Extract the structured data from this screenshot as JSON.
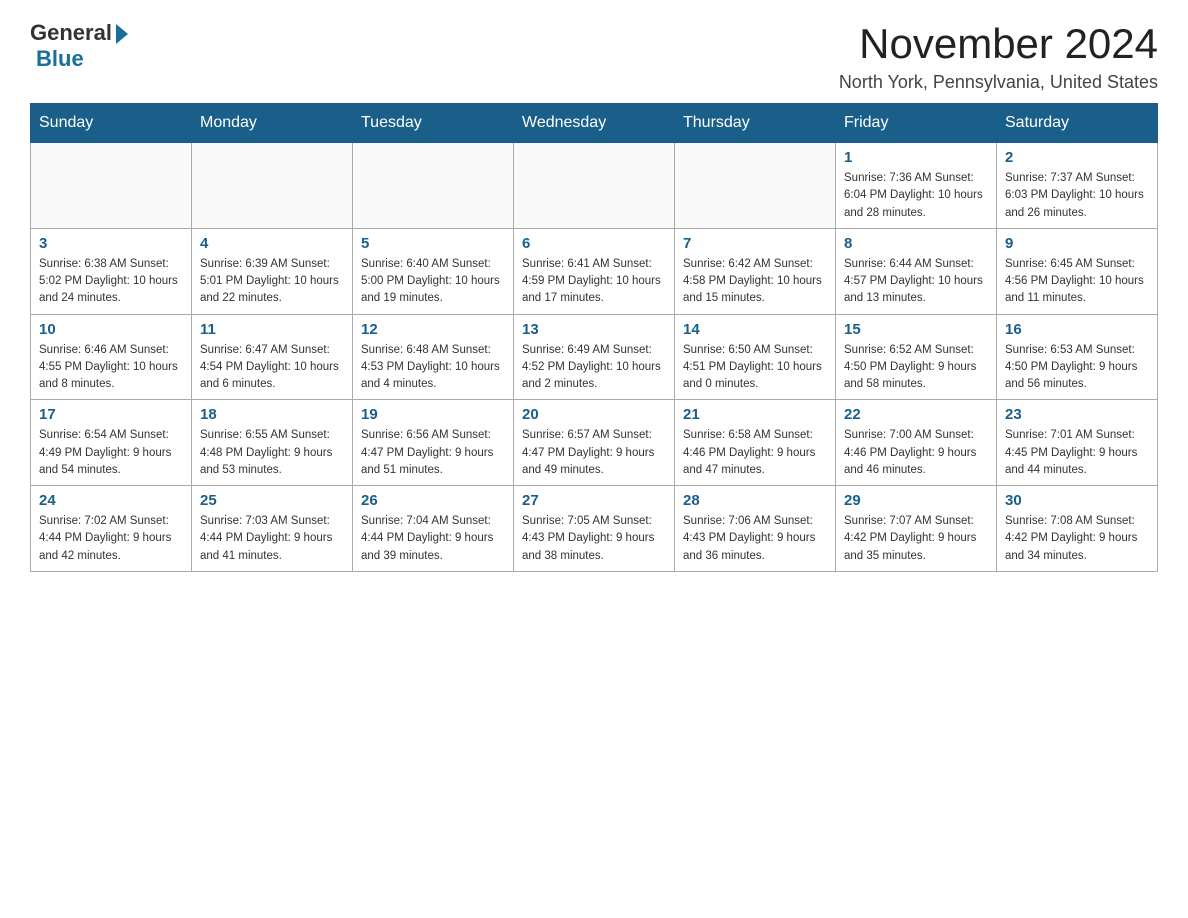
{
  "header": {
    "logo_general": "General",
    "logo_blue": "Blue",
    "month_year": "November 2024",
    "location": "North York, Pennsylvania, United States"
  },
  "days_of_week": [
    "Sunday",
    "Monday",
    "Tuesday",
    "Wednesday",
    "Thursday",
    "Friday",
    "Saturday"
  ],
  "weeks": [
    [
      {
        "day": "",
        "info": ""
      },
      {
        "day": "",
        "info": ""
      },
      {
        "day": "",
        "info": ""
      },
      {
        "day": "",
        "info": ""
      },
      {
        "day": "",
        "info": ""
      },
      {
        "day": "1",
        "info": "Sunrise: 7:36 AM\nSunset: 6:04 PM\nDaylight: 10 hours and 28 minutes."
      },
      {
        "day": "2",
        "info": "Sunrise: 7:37 AM\nSunset: 6:03 PM\nDaylight: 10 hours and 26 minutes."
      }
    ],
    [
      {
        "day": "3",
        "info": "Sunrise: 6:38 AM\nSunset: 5:02 PM\nDaylight: 10 hours and 24 minutes."
      },
      {
        "day": "4",
        "info": "Sunrise: 6:39 AM\nSunset: 5:01 PM\nDaylight: 10 hours and 22 minutes."
      },
      {
        "day": "5",
        "info": "Sunrise: 6:40 AM\nSunset: 5:00 PM\nDaylight: 10 hours and 19 minutes."
      },
      {
        "day": "6",
        "info": "Sunrise: 6:41 AM\nSunset: 4:59 PM\nDaylight: 10 hours and 17 minutes."
      },
      {
        "day": "7",
        "info": "Sunrise: 6:42 AM\nSunset: 4:58 PM\nDaylight: 10 hours and 15 minutes."
      },
      {
        "day": "8",
        "info": "Sunrise: 6:44 AM\nSunset: 4:57 PM\nDaylight: 10 hours and 13 minutes."
      },
      {
        "day": "9",
        "info": "Sunrise: 6:45 AM\nSunset: 4:56 PM\nDaylight: 10 hours and 11 minutes."
      }
    ],
    [
      {
        "day": "10",
        "info": "Sunrise: 6:46 AM\nSunset: 4:55 PM\nDaylight: 10 hours and 8 minutes."
      },
      {
        "day": "11",
        "info": "Sunrise: 6:47 AM\nSunset: 4:54 PM\nDaylight: 10 hours and 6 minutes."
      },
      {
        "day": "12",
        "info": "Sunrise: 6:48 AM\nSunset: 4:53 PM\nDaylight: 10 hours and 4 minutes."
      },
      {
        "day": "13",
        "info": "Sunrise: 6:49 AM\nSunset: 4:52 PM\nDaylight: 10 hours and 2 minutes."
      },
      {
        "day": "14",
        "info": "Sunrise: 6:50 AM\nSunset: 4:51 PM\nDaylight: 10 hours and 0 minutes."
      },
      {
        "day": "15",
        "info": "Sunrise: 6:52 AM\nSunset: 4:50 PM\nDaylight: 9 hours and 58 minutes."
      },
      {
        "day": "16",
        "info": "Sunrise: 6:53 AM\nSunset: 4:50 PM\nDaylight: 9 hours and 56 minutes."
      }
    ],
    [
      {
        "day": "17",
        "info": "Sunrise: 6:54 AM\nSunset: 4:49 PM\nDaylight: 9 hours and 54 minutes."
      },
      {
        "day": "18",
        "info": "Sunrise: 6:55 AM\nSunset: 4:48 PM\nDaylight: 9 hours and 53 minutes."
      },
      {
        "day": "19",
        "info": "Sunrise: 6:56 AM\nSunset: 4:47 PM\nDaylight: 9 hours and 51 minutes."
      },
      {
        "day": "20",
        "info": "Sunrise: 6:57 AM\nSunset: 4:47 PM\nDaylight: 9 hours and 49 minutes."
      },
      {
        "day": "21",
        "info": "Sunrise: 6:58 AM\nSunset: 4:46 PM\nDaylight: 9 hours and 47 minutes."
      },
      {
        "day": "22",
        "info": "Sunrise: 7:00 AM\nSunset: 4:46 PM\nDaylight: 9 hours and 46 minutes."
      },
      {
        "day": "23",
        "info": "Sunrise: 7:01 AM\nSunset: 4:45 PM\nDaylight: 9 hours and 44 minutes."
      }
    ],
    [
      {
        "day": "24",
        "info": "Sunrise: 7:02 AM\nSunset: 4:44 PM\nDaylight: 9 hours and 42 minutes."
      },
      {
        "day": "25",
        "info": "Sunrise: 7:03 AM\nSunset: 4:44 PM\nDaylight: 9 hours and 41 minutes."
      },
      {
        "day": "26",
        "info": "Sunrise: 7:04 AM\nSunset: 4:44 PM\nDaylight: 9 hours and 39 minutes."
      },
      {
        "day": "27",
        "info": "Sunrise: 7:05 AM\nSunset: 4:43 PM\nDaylight: 9 hours and 38 minutes."
      },
      {
        "day": "28",
        "info": "Sunrise: 7:06 AM\nSunset: 4:43 PM\nDaylight: 9 hours and 36 minutes."
      },
      {
        "day": "29",
        "info": "Sunrise: 7:07 AM\nSunset: 4:42 PM\nDaylight: 9 hours and 35 minutes."
      },
      {
        "day": "30",
        "info": "Sunrise: 7:08 AM\nSunset: 4:42 PM\nDaylight: 9 hours and 34 minutes."
      }
    ]
  ]
}
